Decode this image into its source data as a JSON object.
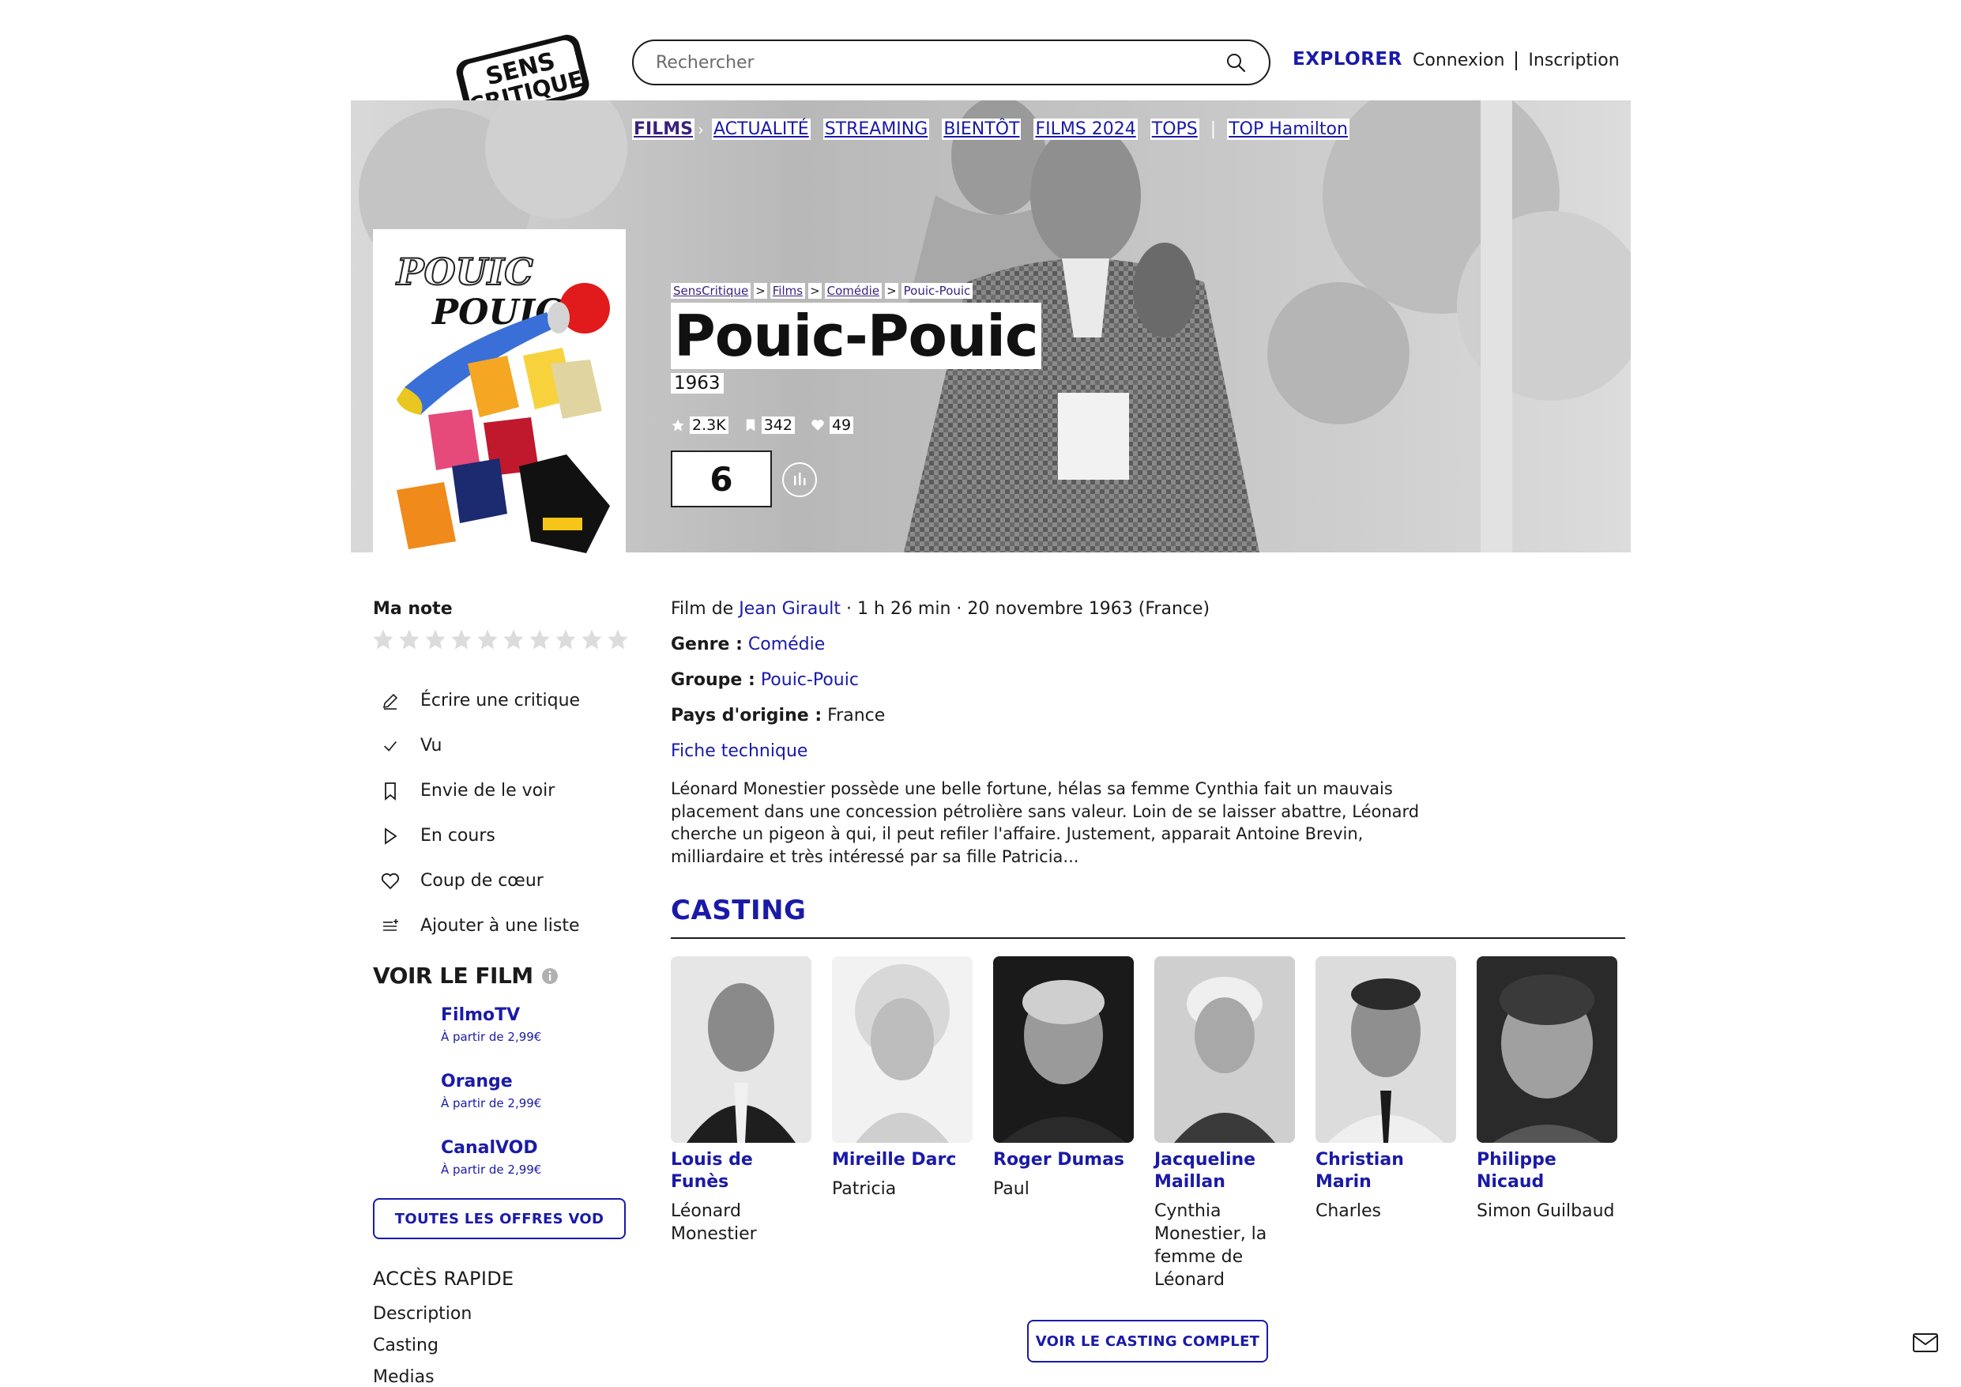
{
  "header": {
    "logo_line1": "SENS",
    "logo_line2": "CRITIQUE",
    "search_placeholder": "Rechercher",
    "explorer": "EXPLORER",
    "login": "Connexion",
    "signup": "Inscription"
  },
  "subnav": {
    "items": [
      "FILMS",
      "ACTUALITÉ",
      "STREAMING",
      "BIENTÔT",
      "FILMS 2024",
      "TOPS",
      "TOP Hamilton"
    ]
  },
  "breadcrumb": [
    "SensCritique",
    "Films",
    "Comédie",
    "Pouic-Pouic"
  ],
  "movie": {
    "title": "Pouic-Pouic",
    "year": "1963",
    "stats": {
      "ratings": "2.3K",
      "wishlist": "342",
      "favorites": "49"
    },
    "score": "6"
  },
  "poster": {
    "title_line1": "POUIC",
    "title_line2": "POUIC"
  },
  "sidebar": {
    "my_rating_label": "Ma note",
    "stars_count": 10,
    "actions": [
      {
        "label": "Écrire une critique",
        "icon": "pencil-icon"
      },
      {
        "label": "Vu",
        "icon": "check-icon"
      },
      {
        "label": "Envie de le voir",
        "icon": "bookmark-icon"
      },
      {
        "label": "En cours",
        "icon": "play-icon"
      },
      {
        "label": "Coup de cœur",
        "icon": "heart-icon"
      },
      {
        "label": "Ajouter à une liste",
        "icon": "list-add-icon"
      }
    ],
    "watch_title": "VOIR LE FILM",
    "vod": [
      {
        "name": "FilmoTV",
        "price": "À partir de 2,99€"
      },
      {
        "name": "Orange",
        "price": "À partir de 2,99€"
      },
      {
        "name": "CanalVOD",
        "price": "À partir de 2,99€"
      }
    ],
    "all_vod_button": "TOUTES LES OFFRES VOD",
    "quick_access_title": "ACCÈS RAPIDE",
    "quick_links": [
      "Description",
      "Casting",
      "Medias"
    ]
  },
  "details": {
    "film_by_prefix": "Film de",
    "director": "Jean Girault",
    "meta_suffix": "· 1 h 26 min · 20 novembre 1963 (France)",
    "genre_label": "Genre :",
    "genre": "Comédie",
    "group_label": "Groupe :",
    "group": "Pouic-Pouic",
    "country_label": "Pays d'origine :",
    "country": "France",
    "tech_sheet": "Fiche technique",
    "synopsis": "Léonard Monestier possède une belle fortune, hélas sa femme Cynthia fait un mauvais placement dans une concession pétrolière sans valeur. Loin de se laisser abattre, Léonard cherche un pigeon à qui, il peut refiler l'affaire. Justement, apparait Antoine Brevin, milliardaire et très intéressé par sa fille Patricia..."
  },
  "casting": {
    "title": "CASTING",
    "actors": [
      {
        "name": "Louis de Funès",
        "role": "Léonard Monestier"
      },
      {
        "name": "Mireille Darc",
        "role": "Patricia"
      },
      {
        "name": "Roger Dumas",
        "role": "Paul"
      },
      {
        "name": "Jacqueline Maillan",
        "role": "Cynthia Monestier, la femme de Léonard"
      },
      {
        "name": "Christian Marin",
        "role": "Charles"
      },
      {
        "name": "Philippe Nicaud",
        "role": "Simon Guilbaud"
      }
    ],
    "full_cast_button": "VOIR LE CASTING COMPLET"
  },
  "colors": {
    "brand_blue": "#1a1aa8",
    "purple": "#3a1f80",
    "text": "#1b1b1b"
  }
}
